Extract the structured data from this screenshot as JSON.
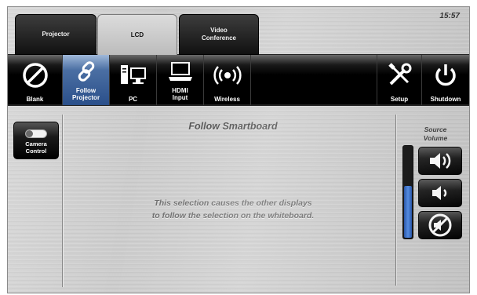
{
  "clock": "15:57",
  "tabs": [
    {
      "label": "Projector"
    },
    {
      "label": "LCD"
    },
    {
      "label": "Video\nConference"
    }
  ],
  "toolbar": {
    "blank": "Blank",
    "follow": "Follow\nProjector",
    "pc": "PC",
    "hdmi": "HDMI\nInput",
    "wireless": "Wireless",
    "setup": "Setup",
    "shutdown": "Shutdown"
  },
  "camera": {
    "label": "Camera\nControl"
  },
  "main": {
    "title": "Follow Smartboard",
    "message": "This selection causes the other displays\nto follow the selection on the whiteboard."
  },
  "volume": {
    "label": "Source\nVolume",
    "level_fraction": 0.58
  },
  "colors": {
    "active_tab": "#cfcfcf",
    "active_button": "#3a5f98",
    "volume_fill": "#3b78d8"
  }
}
